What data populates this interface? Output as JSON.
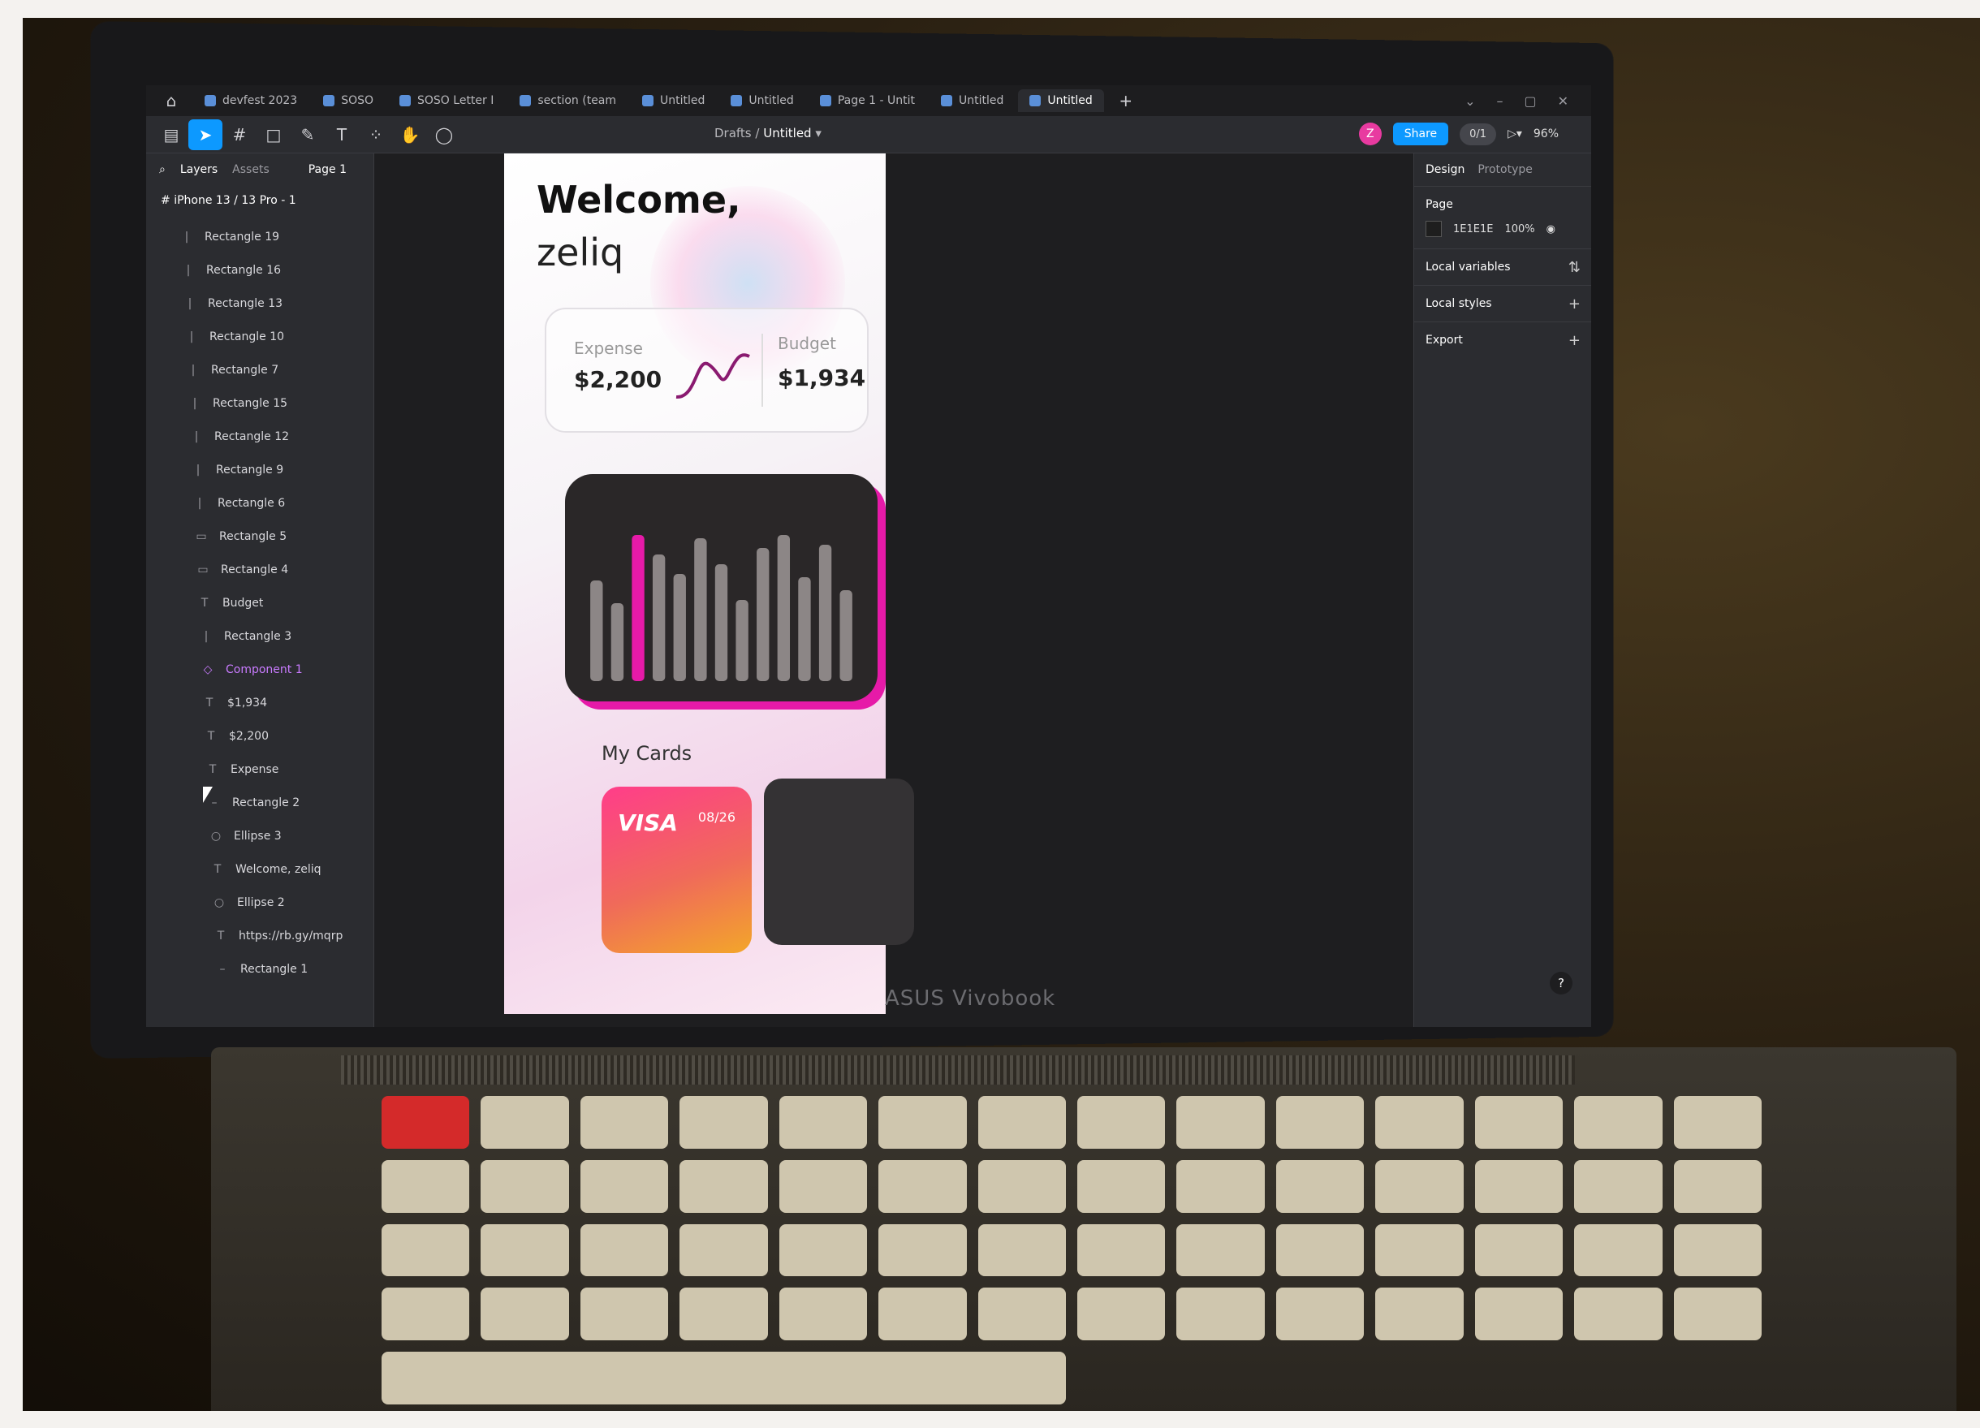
{
  "tabs": [
    {
      "label": "devfest 2023",
      "active": false
    },
    {
      "label": "SOSO",
      "active": false
    },
    {
      "label": "SOSO Letter I",
      "active": false
    },
    {
      "label": "section (team",
      "active": false
    },
    {
      "label": "Untitled",
      "active": false
    },
    {
      "label": "Untitled",
      "active": false
    },
    {
      "label": "Page 1 - Untit",
      "active": false
    },
    {
      "label": "Untitled",
      "active": false
    },
    {
      "label": "Untitled",
      "active": true
    }
  ],
  "toolbar": {
    "breadcrumb_parent": "Drafts",
    "breadcrumb_sep": "/",
    "breadcrumb_current": "Untitled",
    "share_label": "Share",
    "zoom": "96%",
    "avatar_letter": "Z",
    "pill": "0/1"
  },
  "layers_panel": {
    "tab_layers": "Layers",
    "tab_assets": "Assets",
    "page": "Page 1",
    "frame": "iPhone 13 / 13 Pro - 1",
    "items": [
      {
        "label": "Rectangle 19",
        "icon": "|"
      },
      {
        "label": "Rectangle 16",
        "icon": "|"
      },
      {
        "label": "Rectangle 13",
        "icon": "|"
      },
      {
        "label": "Rectangle 10",
        "icon": "|"
      },
      {
        "label": "Rectangle 7",
        "icon": "|"
      },
      {
        "label": "Rectangle 15",
        "icon": "|"
      },
      {
        "label": "Rectangle 12",
        "icon": "|"
      },
      {
        "label": "Rectangle 9",
        "icon": "|"
      },
      {
        "label": "Rectangle 6",
        "icon": "|"
      },
      {
        "label": "Rectangle 5",
        "icon": "▭"
      },
      {
        "label": "Rectangle 4",
        "icon": "▭"
      },
      {
        "label": "Budget",
        "icon": "T"
      },
      {
        "label": "Rectangle 3",
        "icon": "|"
      },
      {
        "label": "Component 1",
        "icon": "◇"
      },
      {
        "label": "$1,934",
        "icon": "T"
      },
      {
        "label": "$2,200",
        "icon": "T"
      },
      {
        "label": "Expense",
        "icon": "T"
      },
      {
        "label": "Rectangle 2",
        "icon": "–"
      },
      {
        "label": "Ellipse 3",
        "icon": "○"
      },
      {
        "label": "Welcome, zeliq",
        "icon": "T"
      },
      {
        "label": "Ellipse 2",
        "icon": "○"
      },
      {
        "label": "https://rb.gy/mqrp",
        "icon": "T"
      },
      {
        "label": "Rectangle 1",
        "icon": "–"
      }
    ]
  },
  "app": {
    "welcome": "Welcome,",
    "name": "zeliq",
    "expense_label": "Expense",
    "expense_value": "$2,200",
    "budget_label": "Budget",
    "budget_value": "$1,934",
    "bars": [
      0.62,
      0.48,
      0.9,
      0.78,
      0.66,
      0.88,
      0.72,
      0.5,
      0.82,
      0.9,
      0.64,
      0.84,
      0.56
    ],
    "highlight_bar": 2,
    "cards_title": "My Cards",
    "visa_logo": "VISA",
    "visa_date": "08/26",
    "colors": {
      "accent": "#e61aa8",
      "bar": "#8c8686",
      "card_dark": "#2a2728"
    }
  },
  "design_panel": {
    "tab_design": "Design",
    "tab_prototype": "Prototype",
    "page_label": "Page",
    "page_color": "1E1E1E",
    "page_opacity": "100%",
    "local_variables": "Local variables",
    "local_styles": "Local styles",
    "export": "Export",
    "help": "?"
  },
  "laptop": {
    "brand": "ASUS Vivobook"
  }
}
